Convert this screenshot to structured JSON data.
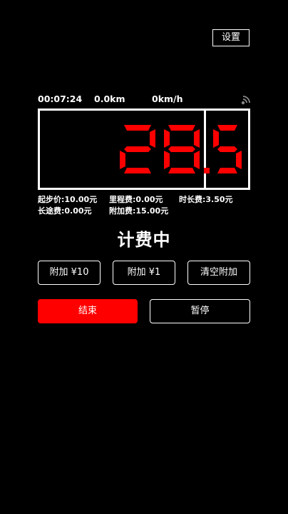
{
  "header": {
    "settings_label": "设置"
  },
  "stats": {
    "elapsed_time": "00:07:24",
    "distance": "0.0km",
    "speed": "0km/h",
    "signal_icon": "signal-icon"
  },
  "meter": {
    "integer_part": "28.",
    "decimal_part": "5",
    "digit_color": "#ff0000"
  },
  "fees": {
    "start_fee": "起步价:10.00元",
    "mileage_fee": "里程费:0.00元",
    "time_fee": "时长费:3.50元",
    "long_distance_fee": "长途费:0.00元",
    "extra_fee": "附加费:15.00元"
  },
  "status": {
    "label": "计费中"
  },
  "buttons": {
    "add_10": "附加 ¥10",
    "add_1": "附加 ¥1",
    "clear_extra": "清空附加",
    "end": "结束",
    "pause": "暂停"
  },
  "colors": {
    "accent_red": "#ff0000",
    "background": "#000000",
    "foreground": "#ffffff"
  }
}
